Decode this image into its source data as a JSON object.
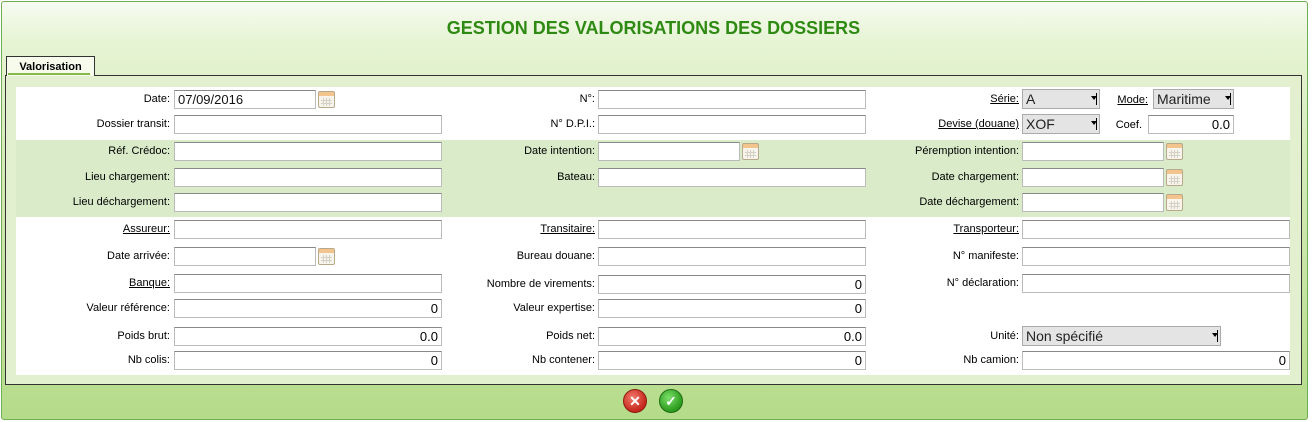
{
  "header": {
    "title": "GESTION DES VALORISATIONS DES DOSSIERS"
  },
  "tabs": [
    {
      "label": "Valorisation"
    }
  ],
  "form": {
    "date": {
      "label": "Date:",
      "value": "07/09/2016"
    },
    "dossier_transit": {
      "label": "Dossier transit:",
      "value": ""
    },
    "numero": {
      "label": "N°:",
      "value": ""
    },
    "numero_dpi": {
      "label": "N° D.P.I.:",
      "value": ""
    },
    "serie": {
      "label": "Série:",
      "value": "A"
    },
    "mode": {
      "label": "Mode:",
      "value": "Maritime"
    },
    "devise": {
      "label": "Devise (douane)",
      "value": "XOF"
    },
    "coef": {
      "label": "Coef.",
      "value": "0.0"
    },
    "ref_credoc": {
      "label": "Réf. Crédoc:",
      "value": ""
    },
    "lieu_chargement": {
      "label": "Lieu chargement:",
      "value": ""
    },
    "lieu_dechargement": {
      "label": "Lieu déchargement:",
      "value": ""
    },
    "date_intention": {
      "label": "Date intention:",
      "value": ""
    },
    "bateau": {
      "label": "Bateau:",
      "value": ""
    },
    "peremption_intention": {
      "label": "Péremption intention:",
      "value": ""
    },
    "date_chargement": {
      "label": "Date chargement:",
      "value": ""
    },
    "date_dechargement": {
      "label": "Date déchargement:",
      "value": ""
    },
    "assureur": {
      "label": "Assureur:",
      "value": ""
    },
    "date_arrivee": {
      "label": "Date arrivée:",
      "value": ""
    },
    "banque": {
      "label": "Banque:",
      "value": ""
    },
    "valeur_reference": {
      "label": "Valeur référence:",
      "value": "0"
    },
    "poids_brut": {
      "label": "Poids brut:",
      "value": "0.0"
    },
    "nb_colis": {
      "label": "Nb colis:",
      "value": "0"
    },
    "transitaire": {
      "label": "Transitaire:",
      "value": ""
    },
    "bureau_douane": {
      "label": "Bureau douane:",
      "value": ""
    },
    "nombre_virements": {
      "label": "Nombre de virements:",
      "value": "0"
    },
    "valeur_expertise": {
      "label": "Valeur expertise:",
      "value": "0"
    },
    "poids_net": {
      "label": "Poids net:",
      "value": "0.0"
    },
    "nb_conteneur": {
      "label": "Nb contener:",
      "value": "0"
    },
    "transporteur": {
      "label": "Transporteur:",
      "value": ""
    },
    "numero_manifeste": {
      "label": "N° manifeste:",
      "value": ""
    },
    "numero_declaration": {
      "label": "N° déclaration:",
      "value": ""
    },
    "unite": {
      "label": "Unité:",
      "value": "Non spécifié"
    },
    "nb_camion": {
      "label": "Nb camion:",
      "value": "0"
    }
  },
  "actions": {
    "cancel_icon": "✕",
    "ok_icon": "✓"
  },
  "colors": {
    "title": "#2f8a14",
    "accent": "#b4db89",
    "cancel": "#c4261b",
    "ok": "#2a9a1c"
  }
}
